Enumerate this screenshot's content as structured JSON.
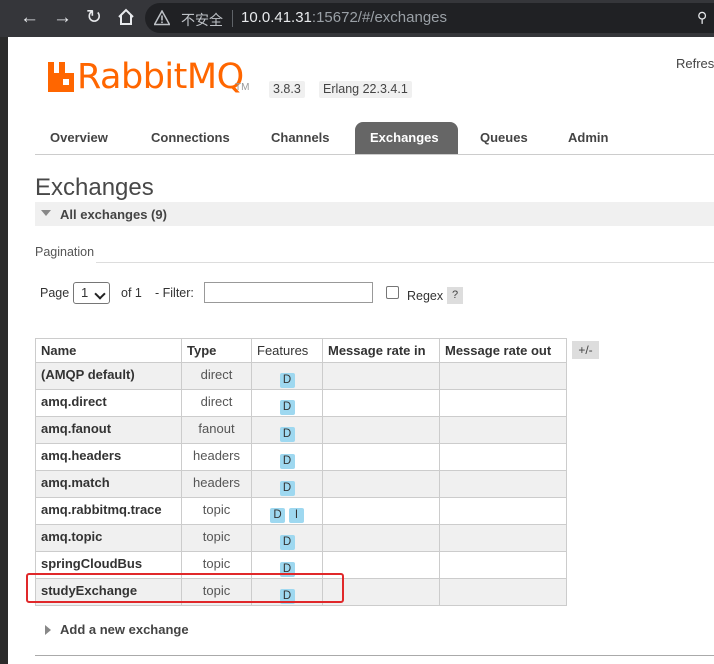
{
  "browser": {
    "security_label": "不安全",
    "url_host": "10.0.41.31",
    "url_rest": ":15672/#/exchanges"
  },
  "header": {
    "logo_text": "RabbitMQ",
    "logo_tm": "TM",
    "version": "3.8.3",
    "erlang": "Erlang 22.3.4.1",
    "refresh_label": "Refres",
    "brand_color": "#ff6600"
  },
  "nav": {
    "tabs": [
      {
        "label": "Overview"
      },
      {
        "label": "Connections"
      },
      {
        "label": "Channels"
      },
      {
        "label": "Exchanges",
        "active": true
      },
      {
        "label": "Queues"
      },
      {
        "label": "Admin"
      }
    ]
  },
  "main": {
    "title": "Exchanges",
    "section_title": "All exchanges (9)",
    "pagination": {
      "label": "Pagination",
      "page_label": "Page",
      "page_value": "1",
      "of_label": "of 1",
      "filter_label": "- Filter:",
      "filter_value": "",
      "regex_label": "Regex",
      "help_label": "?"
    },
    "table": {
      "headers": {
        "name": "Name",
        "type": "Type",
        "features": "Features",
        "rate_in": "Message rate in",
        "rate_out": "Message rate out"
      },
      "toggle_label": "+/-",
      "rows": [
        {
          "name": "(AMQP default)",
          "type": "direct",
          "features": [
            "D"
          ]
        },
        {
          "name": "amq.direct",
          "type": "direct",
          "features": [
            "D"
          ]
        },
        {
          "name": "amq.fanout",
          "type": "fanout",
          "features": [
            "D"
          ]
        },
        {
          "name": "amq.headers",
          "type": "headers",
          "features": [
            "D"
          ]
        },
        {
          "name": "amq.match",
          "type": "headers",
          "features": [
            "D"
          ]
        },
        {
          "name": "amq.rabbitmq.trace",
          "type": "topic",
          "features": [
            "D",
            "I"
          ]
        },
        {
          "name": "amq.topic",
          "type": "topic",
          "features": [
            "D"
          ]
        },
        {
          "name": "springCloudBus",
          "type": "topic",
          "features": [
            "D"
          ]
        },
        {
          "name": "studyExchange",
          "type": "topic",
          "features": [
            "D"
          ],
          "highlighted": true
        }
      ]
    },
    "add_exchange_label": "Add a new exchange"
  }
}
